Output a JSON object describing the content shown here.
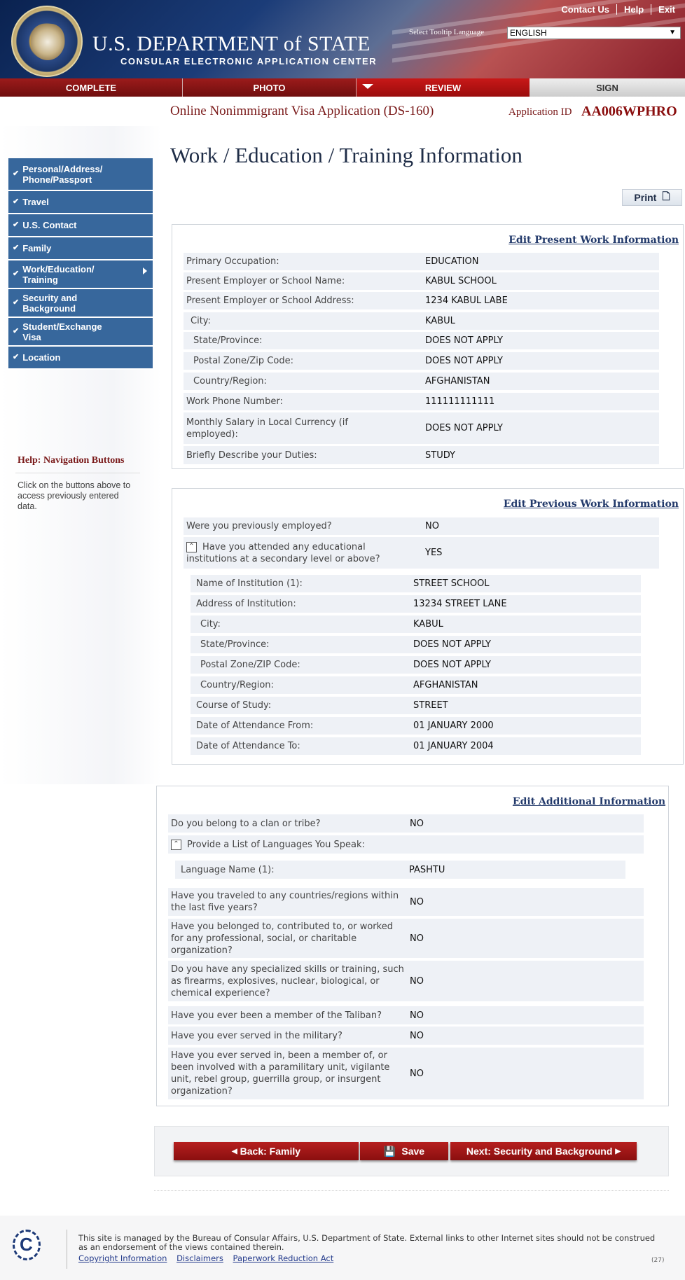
{
  "header": {
    "dept": "U.S. DEPARTMENT of STATE",
    "ceac": "CONSULAR ELECTRONIC APPLICATION CENTER",
    "tooltip_label": "Select Tooltip Language",
    "language": "ENGLISH",
    "links": [
      "Contact Us",
      "Help",
      "Exit"
    ]
  },
  "nav": {
    "tabs": [
      "COMPLETE",
      "PHOTO",
      "REVIEW",
      "SIGN"
    ]
  },
  "form": {
    "title": "Online Nonimmigrant Visa Application (DS-160)",
    "appid_label": "Application ID",
    "appid": "AA006WPHRO"
  },
  "page_title": "Work / Education / Training Information",
  "print_label": "Print",
  "sidebar": {
    "items": [
      "Personal/Address/ Phone/Passport",
      "Travel",
      "U.S. Contact",
      "Family",
      "Work/Education/ Training",
      "Security and Background",
      "Student/Exchange Visa",
      "Location"
    ]
  },
  "help": {
    "title": "Help:",
    "topic": "Navigation Buttons",
    "text": "Click on the buttons above to access previously entered data."
  },
  "present": {
    "edit": "Edit Present Work Information",
    "rows": [
      {
        "label": "Primary Occupation:",
        "value": "EDUCATION"
      },
      {
        "label": "Present Employer or School Name:",
        "value": "KABUL SCHOOL"
      },
      {
        "label": "Present Employer or School Address:",
        "value": "1234 KABUL LABE"
      },
      {
        "label": "City:",
        "value": "KABUL"
      },
      {
        "label": "State/Province:",
        "value": "DOES NOT APPLY"
      },
      {
        "label": "Postal Zone/Zip Code:",
        "value": "DOES NOT APPLY"
      },
      {
        "label": "Country/Region:",
        "value": "AFGHANISTAN"
      },
      {
        "label": "Work Phone Number:",
        "value": "111111111111"
      },
      {
        "label": "Monthly Salary in Local Currency (if employed):",
        "value": "DOES NOT APPLY"
      },
      {
        "label": "Briefly Describe your Duties:",
        "value": "STUDY"
      }
    ]
  },
  "previous": {
    "edit": "Edit Previous Work Information",
    "rows": [
      {
        "label": "Were you previously employed?",
        "value": "NO"
      },
      {
        "label": "Have you attended any educational institutions at a secondary level or above?",
        "value": "YES"
      },
      {
        "label": "Name of Institution (1):",
        "value": "STREET SCHOOL"
      },
      {
        "label": "Address of Institution:",
        "value": "13234 STREET LANE"
      },
      {
        "label": "City:",
        "value": "KABUL"
      },
      {
        "label": "State/Province:",
        "value": "DOES NOT APPLY"
      },
      {
        "label": "Postal Zone/ZIP Code:",
        "value": "DOES NOT APPLY"
      },
      {
        "label": "Country/Region:",
        "value": "AFGHANISTAN"
      },
      {
        "label": "Course of Study:",
        "value": "STREET"
      },
      {
        "label": "Date of Attendance From:",
        "value": "01 JANUARY 2000"
      },
      {
        "label": "Date of Attendance To:",
        "value": "01 JANUARY 2004"
      }
    ]
  },
  "additional": {
    "edit": "Edit Additional Information",
    "rows": [
      {
        "label": "Do you belong to a clan or tribe?",
        "value": "NO"
      },
      {
        "label": "Provide a List of Languages You Speak:",
        "value": ""
      },
      {
        "label": "Language Name (1):",
        "value": "PASHTU"
      },
      {
        "label": "Have you traveled to any countries/regions within the last five years?",
        "value": "NO"
      },
      {
        "label": "Have you belonged to, contributed to, or worked for any professional, social, or charitable organization?",
        "value": "NO"
      },
      {
        "label": "Do you have any specialized skills or training, such as firearms, explosives, nuclear, biological, or chemical experience?",
        "value": "NO"
      },
      {
        "label": "Have you ever been a member of the Taliban?",
        "value": "NO"
      },
      {
        "label": "Have you ever served in the military?",
        "value": "NO"
      },
      {
        "label": "Have you ever served in, been a member of, or been involved with a paramilitary unit, vigilante unit, rebel group, guerrilla group, or insurgent organization?",
        "value": "NO"
      }
    ]
  },
  "buttons": {
    "back": "Back: Family",
    "save": "Save",
    "next": "Next: Security and Background"
  },
  "footer": {
    "text": "This site is managed by the Bureau of Consular Affairs, U.S. Department of State. External links to other Internet sites should not be construed as an endorsement of the views contained therein.",
    "links": [
      "Copyright Information",
      "Disclaimers",
      "Paperwork Reduction Act"
    ],
    "code": "(27)"
  }
}
